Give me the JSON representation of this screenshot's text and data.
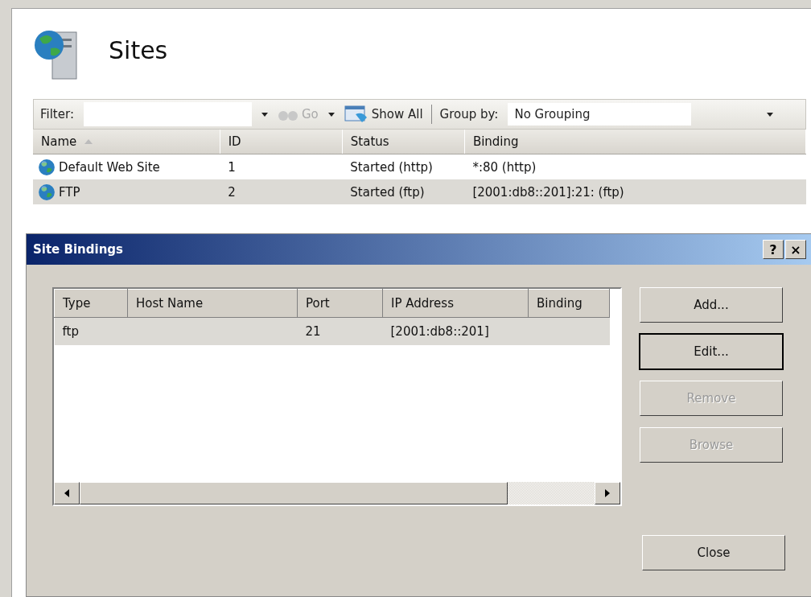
{
  "page": {
    "title": "Sites"
  },
  "toolbar": {
    "filter_label": "Filter:",
    "go": {
      "label": "Go",
      "disabled": true
    },
    "show_all": "Show All",
    "group_by_label": "Group by:",
    "group_by_value": "No Grouping"
  },
  "sites_table": {
    "columns": [
      {
        "label": "Name",
        "sorted": true
      },
      {
        "label": "ID",
        "sorted": false
      },
      {
        "label": "Status",
        "sorted": false
      },
      {
        "label": "Binding",
        "sorted": false
      }
    ],
    "rows": [
      {
        "name": "Default Web Site",
        "id": "1",
        "status": "Started (http)",
        "binding": "*:80 (http)",
        "selected": false
      },
      {
        "name": "FTP",
        "id": "2",
        "status": "Started (ftp)",
        "binding": "[2001:db8::201]:21: (ftp)",
        "selected": true
      }
    ]
  },
  "dialog": {
    "title": "Site Bindings",
    "help": "?",
    "close": "×",
    "columns": [
      "Type",
      "Host Name",
      "Port",
      "IP Address",
      "Binding"
    ],
    "rows": [
      {
        "cells": [
          "ftp",
          "",
          "21",
          "[2001:db8::201]",
          ""
        ],
        "selected": true
      }
    ],
    "buttons": [
      {
        "label": "Add...",
        "disabled": false,
        "focused": false
      },
      {
        "label": "Edit...",
        "disabled": false,
        "focused": true
      },
      {
        "label": "Remove",
        "disabled": true,
        "focused": false
      },
      {
        "label": "Browse",
        "disabled": true,
        "focused": false
      }
    ],
    "close_button": "Close"
  }
}
